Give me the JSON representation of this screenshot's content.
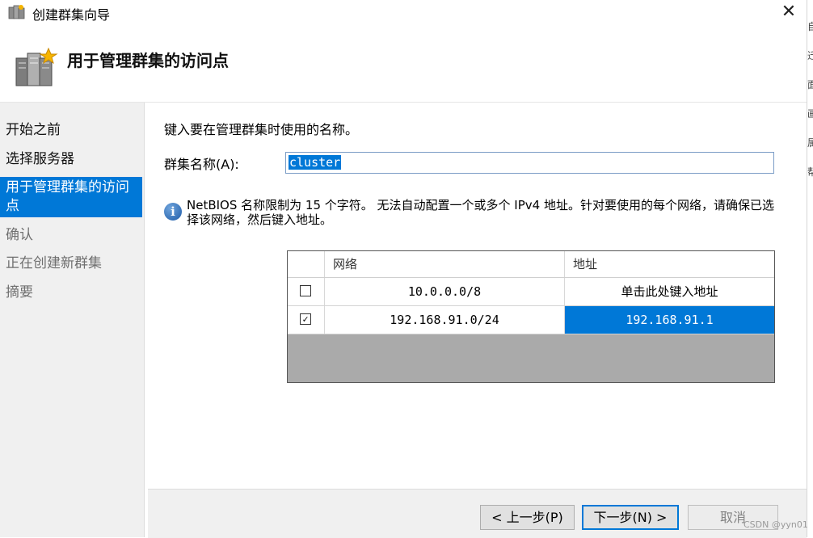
{
  "window": {
    "title": "创建群集向导",
    "close_glyph": "✕"
  },
  "header": {
    "heading": "用于管理群集的访问点",
    "icon": "cluster-servers-icon"
  },
  "sidebar": {
    "steps": [
      {
        "label": "开始之前",
        "state": "done"
      },
      {
        "label": "选择服务器",
        "state": "done"
      },
      {
        "label": "用于管理群集的访问点",
        "state": "active"
      },
      {
        "label": "确认",
        "state": "todo"
      },
      {
        "label": "正在创建新群集",
        "state": "todo"
      },
      {
        "label": "摘要",
        "state": "todo"
      }
    ]
  },
  "main": {
    "prompt": "键入要在管理群集时使用的名称。",
    "name_label": "群集名称(A):",
    "name_value": "cluster",
    "info_text": "NetBIOS 名称限制为 15 个字符。 无法自动配置一个或多个 IPv4 地址。针对要使用的每个网络，请确保已选择该网络，然后键入地址。",
    "grid": {
      "headers": [
        "网络",
        "地址"
      ],
      "rows": [
        {
          "checked": false,
          "network": "10.0.0.0/8",
          "address": "单击此处键入地址"
        },
        {
          "checked": true,
          "network": "192.168.91.0/24",
          "address": "192.168.91.1"
        }
      ]
    }
  },
  "footer": {
    "back_label": "< 上一步(P)",
    "next_label": "下一步(N) >",
    "cancel_label": "取消"
  },
  "watermark": "CSDN @yyn01",
  "colors": {
    "accent": "#0078d7",
    "sidebar_bg": "#f0f0f0",
    "grid_empty": "#aaaaaa"
  }
}
